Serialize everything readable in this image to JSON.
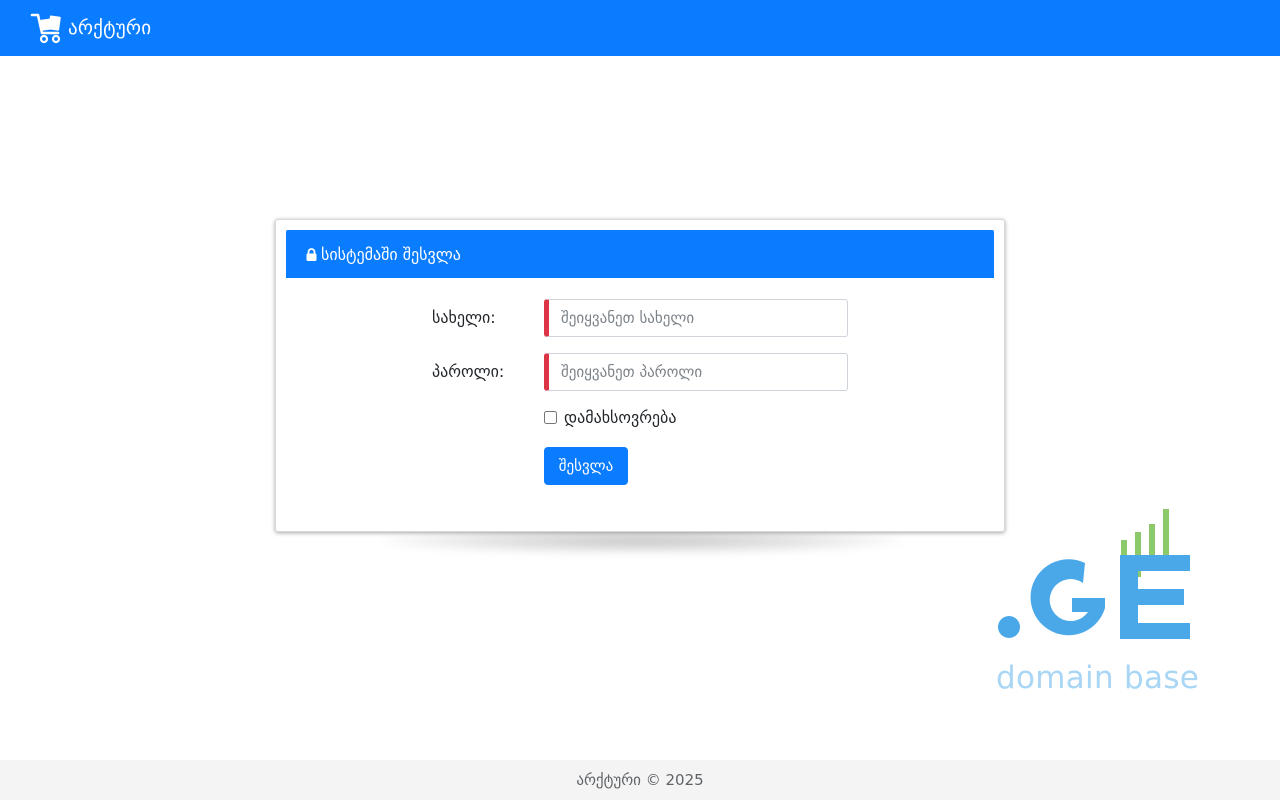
{
  "navbar": {
    "brand": "არქტური",
    "brand_icon": "cart-icon",
    "color": "#0a7cff"
  },
  "login": {
    "title": "სისტემაში შესვლა",
    "title_icon": "lock-icon",
    "username": {
      "label": "სახელი:",
      "placeholder": "შეიყვანეთ სახელი",
      "value": ""
    },
    "password": {
      "label": "პაროლი:",
      "placeholder": "შეიყვანეთ პაროლი",
      "value": ""
    },
    "remember": {
      "label": "დამახსოვრება",
      "checked": false
    },
    "submit_label": "შესვლა",
    "invalid_color": "#dc3545"
  },
  "watermark": {
    "logo": "ge-domain-logo",
    "caption": "domain base",
    "colors": {
      "letters": "#4ba8e8",
      "bars": "#8cc96a",
      "caption": "#a9d6f5"
    }
  },
  "footer": {
    "text": "არქტური © 2025"
  }
}
